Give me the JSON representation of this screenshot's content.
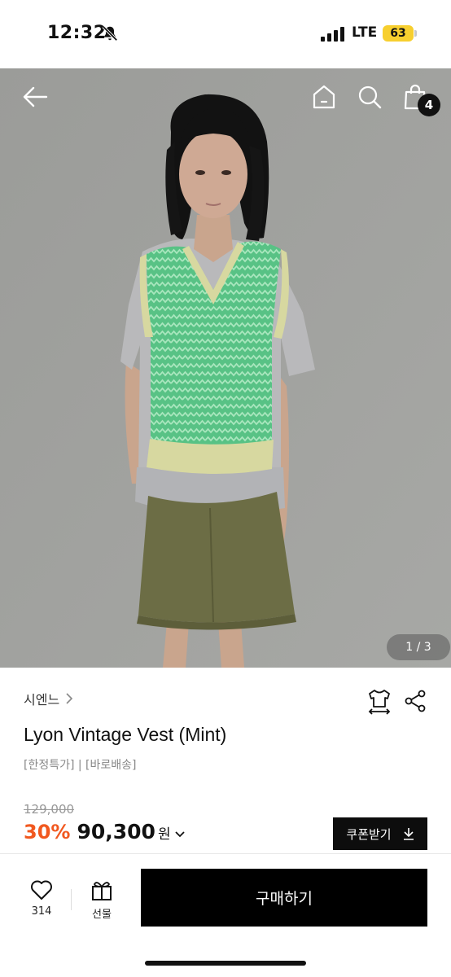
{
  "status_bar": {
    "time": "12:32",
    "network": "LTE",
    "battery": "63"
  },
  "header": {
    "cart_count": "4"
  },
  "gallery": {
    "counter": "1 / 3"
  },
  "product": {
    "brand": "시엔느",
    "title": "Lyon Vintage Vest (Mint)",
    "tags": "[한정특가] | [바로배송]",
    "original_price": "129,000",
    "discount": "30%",
    "sale_price": "90,300",
    "currency": "원",
    "coupon_label": "쿠폰받기"
  },
  "bottom_bar": {
    "like_count": "314",
    "gift_label": "선물",
    "buy_label": "구매하기"
  },
  "colors": {
    "discount": "#f1581f",
    "battery": "#f7cf2f",
    "vest": "#5fc98a",
    "skirt": "#6c6d45"
  }
}
